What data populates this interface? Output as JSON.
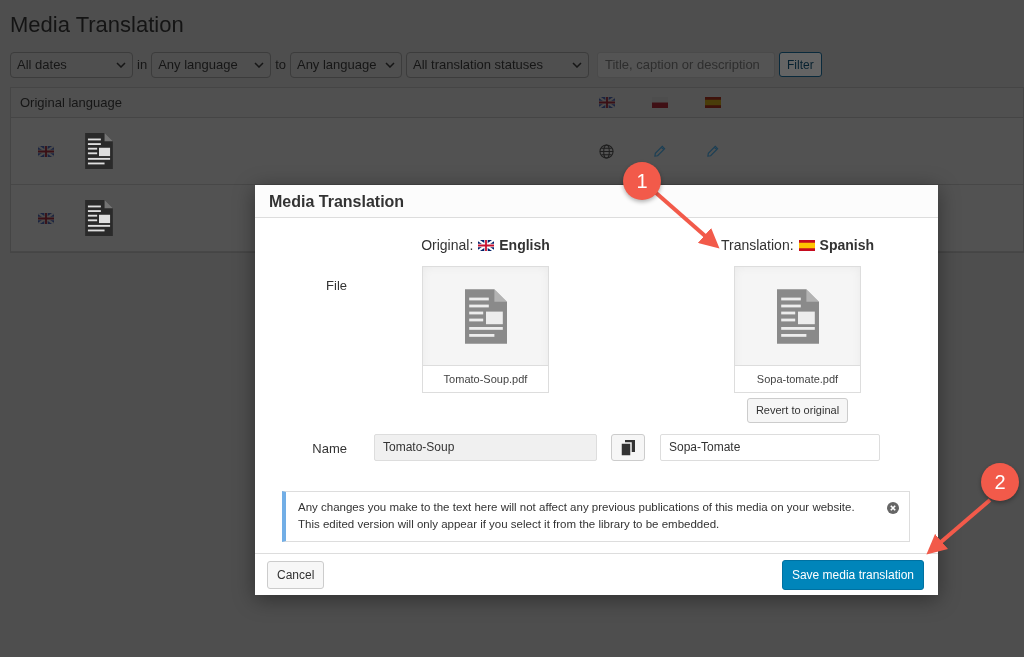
{
  "page": {
    "title": "Media Translation"
  },
  "filters": {
    "date": "All dates",
    "from_label": "in",
    "from": "Any language",
    "to_label": "to",
    "to": "Any language",
    "status": "All translation statuses",
    "search": {
      "placeholder": "Title, caption or description"
    },
    "button": "Filter"
  },
  "table": {
    "header": "Original language",
    "languages": [
      {
        "kind": "uk"
      },
      {
        "kind": "pl"
      },
      {
        "kind": "es"
      }
    ],
    "rows": [
      {
        "flag": {
          "kind": "uk"
        },
        "cells": [
          {
            "kind": "original"
          },
          {
            "kind": "edit"
          },
          {
            "kind": "edit"
          }
        ]
      },
      {
        "flag": {
          "kind": "uk"
        }
      }
    ]
  },
  "dialog": {
    "title": "Media Translation",
    "original_label": "Original:",
    "original_flag": {
      "kind": "uk"
    },
    "original_language": "English",
    "translation_label": "Translation:",
    "translation_flag": {
      "kind": "es"
    },
    "translation_language": "Spanish",
    "file_label": "File",
    "original_file": "Tomato-Soup.pdf",
    "translated_file": "Sopa-tomate.pdf",
    "revert_button": "Revert to original",
    "name_label": "Name",
    "original_name": {
      "value": "Tomato-Soup",
      "disabled": true
    },
    "translated_name": {
      "value": "Sopa-Tomate",
      "disabled": false
    },
    "notice": "Any changes you make to the text here will not affect any previous publications of this media on your website. This edited version will only appear if you select it from the library to be embedded.",
    "cancel_button": "Cancel",
    "save_button": "Save media translation"
  },
  "callouts": [
    "1",
    "2"
  ]
}
